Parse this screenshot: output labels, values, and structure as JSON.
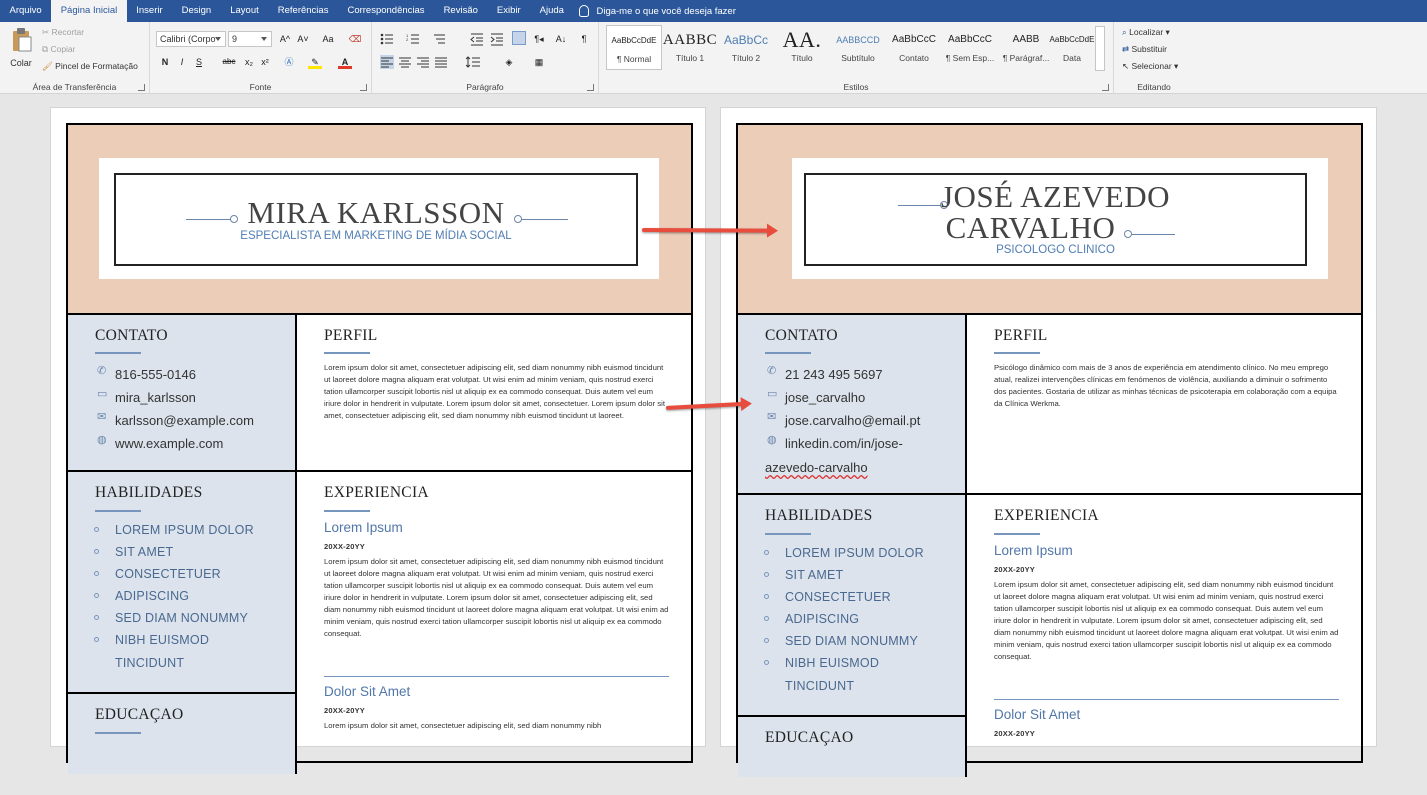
{
  "ribbon": {
    "tabs": [
      "Arquivo",
      "Página Inicial",
      "Inserir",
      "Design",
      "Layout",
      "Referências",
      "Correspondências",
      "Revisão",
      "Exibir",
      "Ajuda"
    ],
    "active_tab": "Página Inicial",
    "tell_me": "Diga-me o que você deseja fazer",
    "clipboard": {
      "paste": "Colar",
      "cut": "Recortar",
      "copy": "Copiar",
      "format_painter": "Pincel de Formatação",
      "label": "Área de Transferência"
    },
    "font": {
      "name": "Calibri (Corpo",
      "size": "9",
      "label": "Fonte",
      "bold": "N",
      "italic": "I",
      "underline": "S",
      "strike": "abc",
      "sub": "x₂",
      "sup": "x²",
      "grow": "A^",
      "shrink": "A˅",
      "case": "Aa"
    },
    "paragraph": {
      "label": "Parágrafo"
    },
    "styles": {
      "label": "Estilos",
      "items": [
        {
          "preview": "AaBbCcDdE",
          "name": "¶ Normal"
        },
        {
          "preview": "AABBC",
          "name": "Título 1"
        },
        {
          "preview": "AaBbCc",
          "name": "Título 2"
        },
        {
          "preview": "AA.",
          "name": "Título"
        },
        {
          "preview": "AABBCCD",
          "name": "Subtítulo"
        },
        {
          "preview": "AaBbCcC",
          "name": "Contato"
        },
        {
          "preview": "AaBbCcC",
          "name": "¶ Sem Esp..."
        },
        {
          "preview": "AABB",
          "name": "¶ Parágraf..."
        },
        {
          "preview": "AaBbCcDdE",
          "name": "Data"
        }
      ]
    },
    "editing": {
      "find": "Localizar",
      "replace": "Substituir",
      "select": "Selecionar",
      "label": "Editando"
    }
  },
  "left": {
    "name": "MIRA KARLSSON",
    "title": "ESPECIALISTA EM MARKETING DE MÍDIA SOCIAL",
    "contact_h": "CONTATO",
    "contacts": [
      "816-555-0146",
      "mira_karlsson",
      "karlsson@example.com",
      "www.example.com"
    ],
    "profile_h": "PERFIL",
    "profile": "Lorem ipsum dolor sit amet, consectetuer adipiscing elit, sed diam nonummy nibh euismod tincidunt ut laoreet dolore magna aliquam erat volutpat. Ut wisi enim ad minim veniam, quis nostrud exerci tation ullamcorper suscipit lobortis nisl ut aliquip ex ea commodo consequat. Duis autem vel eum iriure dolor in hendrerit in vulputate. Lorem ipsum dolor sit amet, consectetuer. Lorem ipsum dolor sit amet, consectetuer adipiscing elit, sed diam nonummy nibh euismod tincidunt ut laoreet.",
    "skills_h": "HABILIDADES",
    "skills": [
      "LOREM IPSUM DOLOR",
      "SIT AMET",
      "CONSECTETUER",
      "ADIPISCING",
      "SED DIAM NONUMMY",
      "NIBH EUISMOD",
      "TINCIDUNT"
    ],
    "exp_h": "EXPERIENCIA",
    "job1": "Lorem Ipsum",
    "date1": "20XX-20YY",
    "job1_text": "Lorem ipsum dolor sit amet, consectetuer adipiscing elit, sed diam nonummy nibh euismod tincidunt ut laoreet dolore magna aliquam erat volutpat. Ut wisi enim ad minim veniam, quis nostrud exerci tation ullamcorper suscipit lobortis nisl ut aliquip ex ea commodo consequat. Duis autem vel eum iriure dolor in hendrerit in vulputate. Lorem ipsum dolor sit amet, consectetuer adipiscing elit, sed diam nonummy nibh euismod tincidunt ut laoreet dolore magna aliquam erat volutpat. Ut wisi enim ad minim veniam, quis nostrud exerci tation ullamcorper suscipit lobortis nisl ut aliquip ex ea commodo consequat.",
    "job2": "Dolor Sit Amet",
    "date2": "20XX-20YY",
    "job2_text": "Lorem ipsum dolor sit amet, consectetuer adipiscing elit, sed diam nonummy nibh",
    "edu_h": "EDUCAÇAO"
  },
  "right": {
    "name1": "JOSÉ AZEVEDO",
    "name2": "CARVALHO",
    "title": "PSICOLOGO CLINICO",
    "contact_h": "CONTATO",
    "contacts": [
      "21 243 495 5697",
      "jose_carvalho",
      "jose.carvalho@email.pt",
      "linkedin.com/in/jose-",
      "azevedo-carvalho"
    ],
    "profile_h": "PERFIL",
    "profile": "Psicólogo dinâmico com mais de 3 anos de experiência em atendimento clínico. No meu emprego atual, realizei intervenções clínicas em fenómenos de violência, auxiliando a diminuir o sofrimento dos pacientes. Gostaria de utilizar as minhas técnicas de psicoterapia em colaboração com a equipa da Clínica Werkma.",
    "skills_h": "HABILIDADES",
    "skills": [
      "LOREM IPSUM DOLOR",
      "SIT AMET",
      "CONSECTETUER",
      "ADIPISCING",
      "SED DIAM NONUMMY",
      "NIBH EUISMOD",
      "TINCIDUNT"
    ],
    "exp_h": "EXPERIENCIA",
    "job1": "Lorem Ipsum",
    "date1": "20XX-20YY",
    "job1_text": "Lorem ipsum dolor sit amet, consectetuer adipiscing elit, sed diam nonummy nibh euismod tincidunt ut laoreet dolore magna aliquam erat volutpat. Ut wisi enim ad minim veniam, quis nostrud exerci tation ullamcorper suscipit lobortis nisl ut aliquip ex ea commodo consequat. Duis autem vel eum iriure dolor in hendrerit in vulputate. Lorem ipsum dolor sit amet, consectetuer adipiscing elit, sed diam nonummy nibh euismod tincidunt ut laoreet dolore magna aliquam erat volutpat. Ut wisi enim ad minim veniam, quis nostrud exerci tation ullamcorper suscipit lobortis nisl ut aliquip ex ea commodo consequat.",
    "job2": "Dolor Sit Amet",
    "date2": "20XX-20YY",
    "edu_h": "EDUCAÇAO"
  }
}
